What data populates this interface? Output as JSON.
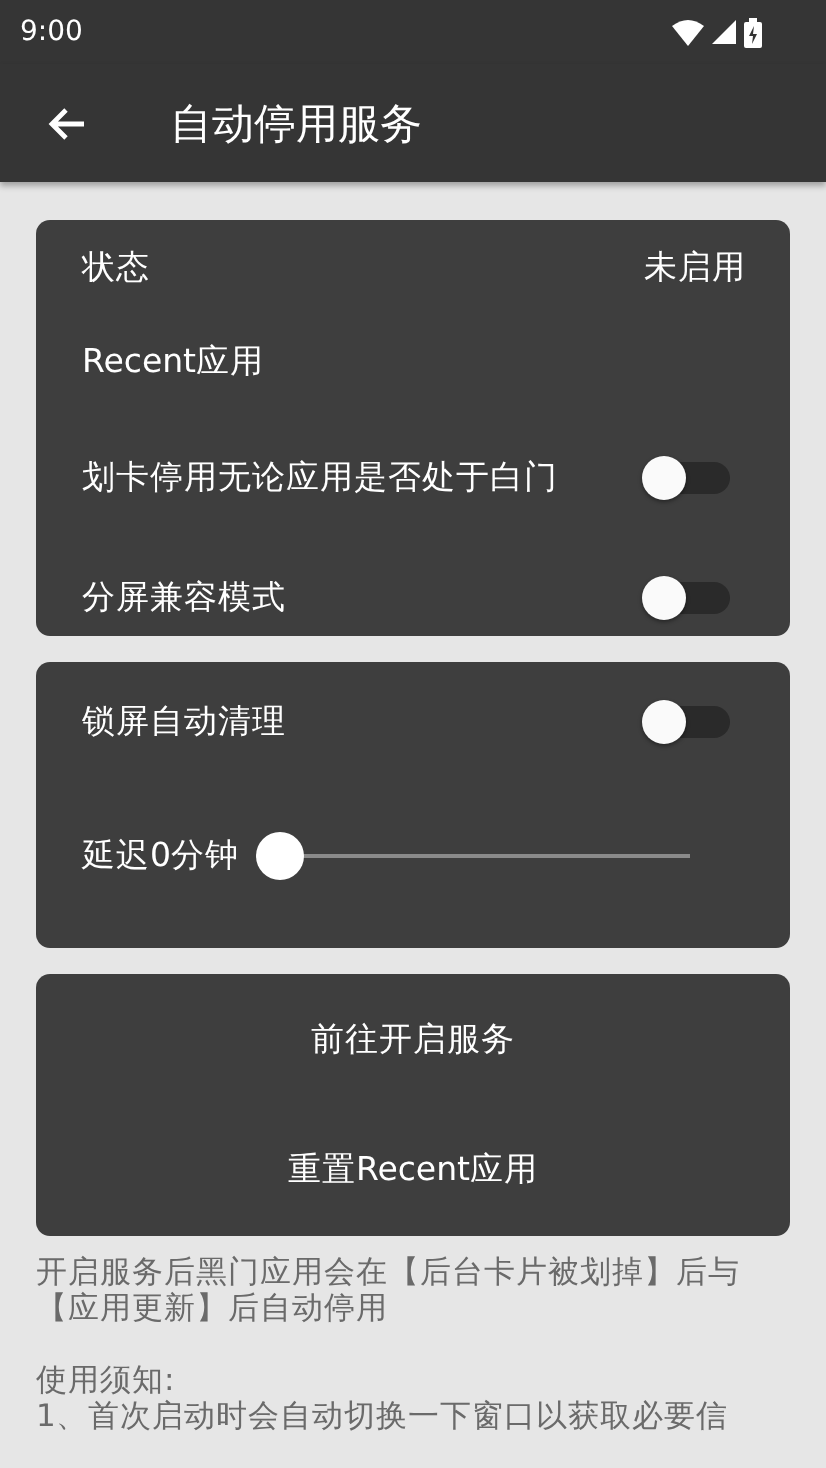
{
  "status_bar": {
    "time": "9:00"
  },
  "app_bar": {
    "title": "自动停用服务"
  },
  "card_1": {
    "status_label": "状态",
    "status_value": "未启用",
    "recent_label": "Recent应用",
    "switches": [
      {
        "label": "划卡停用无论应用是否处于白门",
        "on": false
      },
      {
        "label": "分屏兼容模式",
        "on": false
      }
    ]
  },
  "card_2": {
    "switch": {
      "label": "锁屏自动清理",
      "on": false
    },
    "slider": {
      "label": "延迟0分钟",
      "level": 0
    }
  },
  "card_3": {
    "buttons": [
      "前往开启服务",
      "重置Recent应用"
    ]
  },
  "notes": [
    "开启服务后黑门应用会在【后台卡片被划掉】后与【应用更新】后自动停用",
    "使用须知:",
    "1、首次启动时会自动切换一下窗口以获取必要信"
  ]
}
